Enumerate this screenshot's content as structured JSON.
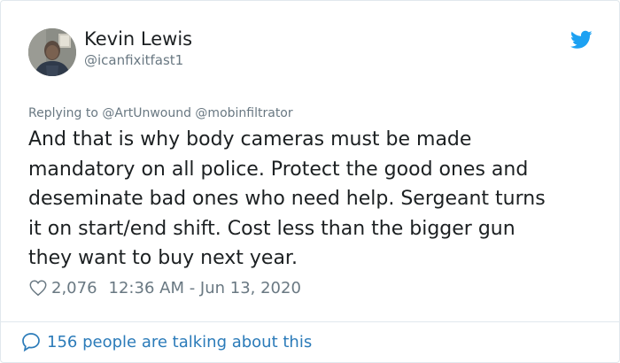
{
  "tweet": {
    "author_name": "Kevin Lewis",
    "author_handle": "@icanfixitfast1",
    "reply_prefix": "Replying to ",
    "reply_to": "@ArtUnwound @mobinfiltrator",
    "text_lines": [
      "And that is why body cameras must be made",
      "mandatory on all police. Protect the good ones and",
      "deseminate bad ones who need help. Sergeant turns",
      "it on start/end shift. Cost less than the bigger gun",
      "they want to buy next year."
    ],
    "like_count": "2,076",
    "timestamp": "12:36 AM - Jun 13, 2020",
    "talking_about": "156 people are talking about this"
  },
  "icons": {
    "brand": "twitter-bird-icon",
    "like": "heart-icon",
    "conversation": "speech-bubble-icon"
  },
  "colors": {
    "twitter_blue": "#1da1f2",
    "link_blue": "#2b7bb9",
    "text_primary": "#1c2022",
    "text_secondary": "#697882",
    "border": "#e1e8ed"
  }
}
